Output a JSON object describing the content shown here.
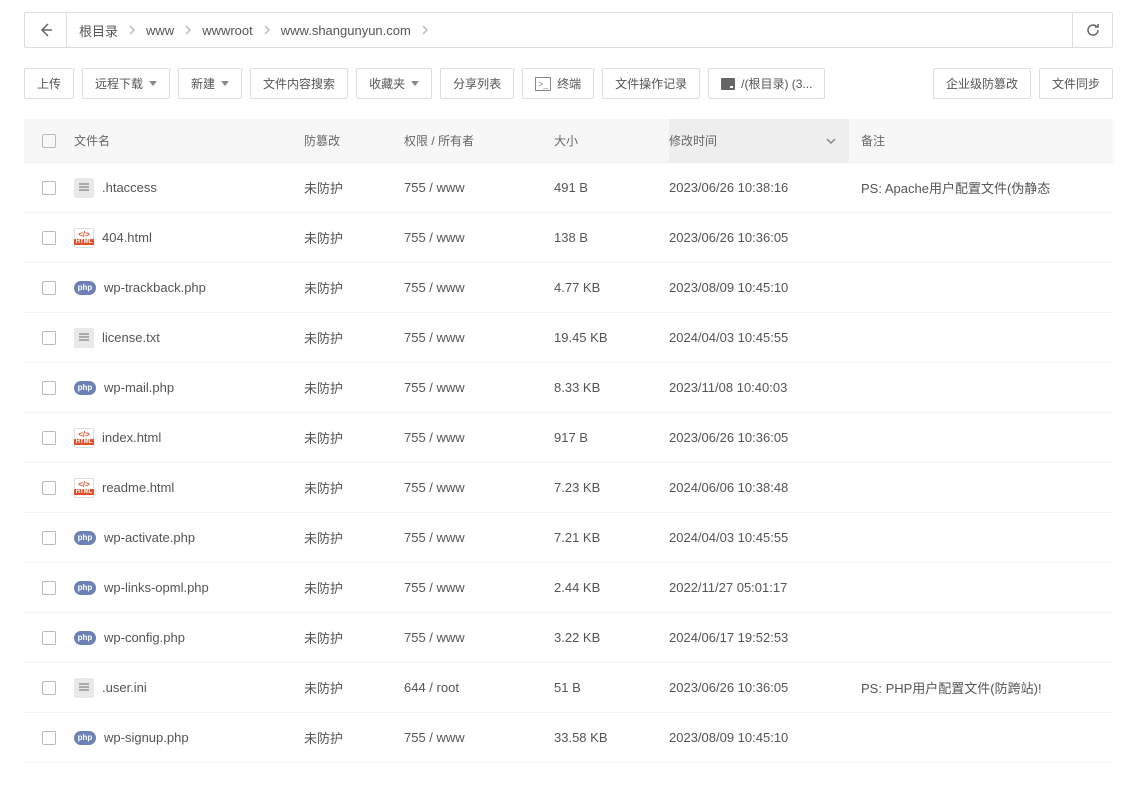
{
  "breadcrumbs": [
    "根目录",
    "www",
    "wwwroot",
    "www.shangunyun.com"
  ],
  "toolbar": {
    "upload": "上传",
    "remote_download": "远程下载",
    "new": "新建",
    "search": "文件内容搜索",
    "favorites": "收藏夹",
    "share": "分享列表",
    "terminal": "终端",
    "log": "文件操作记录",
    "disk": "/(根目录) (3...",
    "tamper_enterprise": "企业级防篡改",
    "sync": "文件同步"
  },
  "columns": {
    "name": "文件名",
    "protect": "防篡改",
    "perm": "权限 / 所有者",
    "size": "大小",
    "mtime": "修改时间",
    "remark": "备注"
  },
  "chart_data": {
    "type": "table",
    "columns": [
      "文件名",
      "防篡改",
      "权限 / 所有者",
      "大小",
      "修改时间",
      "备注"
    ],
    "rows": [
      {
        "name": ".htaccess",
        "icon": "txt",
        "protect": "未防护",
        "perm": "755 / www",
        "size": "491 B",
        "mtime": "2023/06/26 10:38:16",
        "remark": "PS: Apache用户配置文件(伪静态"
      },
      {
        "name": "404.html",
        "icon": "html",
        "protect": "未防护",
        "perm": "755 / www",
        "size": "138 B",
        "mtime": "2023/06/26 10:36:05",
        "remark": ""
      },
      {
        "name": "wp-trackback.php",
        "icon": "php",
        "protect": "未防护",
        "perm": "755 / www",
        "size": "4.77 KB",
        "mtime": "2023/08/09 10:45:10",
        "remark": ""
      },
      {
        "name": "license.txt",
        "icon": "txt",
        "protect": "未防护",
        "perm": "755 / www",
        "size": "19.45 KB",
        "mtime": "2024/04/03 10:45:55",
        "remark": ""
      },
      {
        "name": "wp-mail.php",
        "icon": "php",
        "protect": "未防护",
        "perm": "755 / www",
        "size": "8.33 KB",
        "mtime": "2023/11/08 10:40:03",
        "remark": ""
      },
      {
        "name": "index.html",
        "icon": "html",
        "protect": "未防护",
        "perm": "755 / www",
        "size": "917 B",
        "mtime": "2023/06/26 10:36:05",
        "remark": ""
      },
      {
        "name": "readme.html",
        "icon": "html",
        "protect": "未防护",
        "perm": "755 / www",
        "size": "7.23 KB",
        "mtime": "2024/06/06 10:38:48",
        "remark": ""
      },
      {
        "name": "wp-activate.php",
        "icon": "php",
        "protect": "未防护",
        "perm": "755 / www",
        "size": "7.21 KB",
        "mtime": "2024/04/03 10:45:55",
        "remark": ""
      },
      {
        "name": "wp-links-opml.php",
        "icon": "php",
        "protect": "未防护",
        "perm": "755 / www",
        "size": "2.44 KB",
        "mtime": "2022/11/27 05:01:17",
        "remark": ""
      },
      {
        "name": "wp-config.php",
        "icon": "php",
        "protect": "未防护",
        "perm": "755 / www",
        "size": "3.22 KB",
        "mtime": "2024/06/17 19:52:53",
        "remark": ""
      },
      {
        "name": ".user.ini",
        "icon": "txt",
        "protect": "未防护",
        "perm": "644 / root",
        "size": "51 B",
        "mtime": "2023/06/26 10:36:05",
        "remark": "PS: PHP用户配置文件(防跨站)!"
      },
      {
        "name": "wp-signup.php",
        "icon": "php",
        "protect": "未防护",
        "perm": "755 / www",
        "size": "33.58 KB",
        "mtime": "2023/08/09 10:45:10",
        "remark": ""
      }
    ]
  }
}
